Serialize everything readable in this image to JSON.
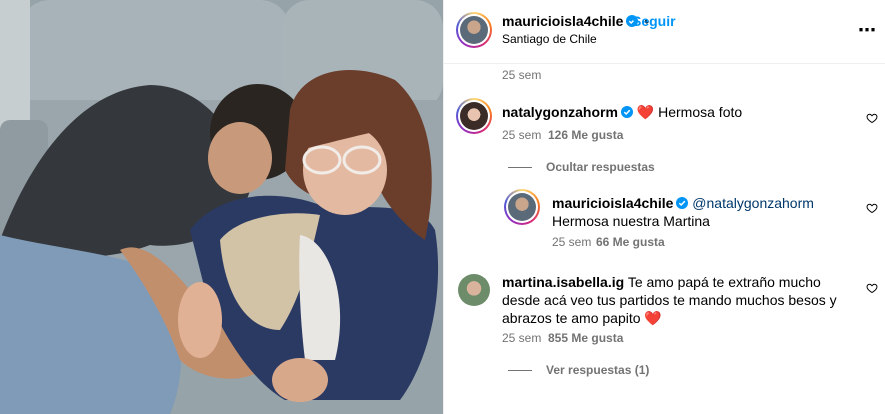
{
  "header": {
    "username": "mauricioisla4chile",
    "dot": "•",
    "follow_label": "Seguir",
    "location": "Santiago de Chile",
    "more_icon": "⋯"
  },
  "caption": {
    "time": "25 sem"
  },
  "comments": [
    {
      "username": "natalygonzahorm",
      "emoji": "❤️",
      "text": "Hermosa foto",
      "time": "25 sem",
      "likes": "126 Me gusta",
      "thread_label": "Ocultar respuestas"
    },
    {
      "username": "mauricioisla4chile",
      "mention": "@natalygonzahorm",
      "text": "Hermosa nuestra Martina",
      "time": "25 sem",
      "likes": "66 Me gusta"
    },
    {
      "username": "martina.isabella.ig",
      "text": "Te amo papá te extraño mucho desde acá veo tus partidos te mando muchos besos y abrazos te amo papito",
      "emoji": "❤️",
      "time": "25 sem",
      "likes": "855 Me gusta",
      "thread_label": "Ver respuestas (1)"
    }
  ],
  "colors": {
    "accent": "#0095f6",
    "verified": "#0095f6",
    "secondary_text": "#737373",
    "heart": "#ff3040"
  }
}
